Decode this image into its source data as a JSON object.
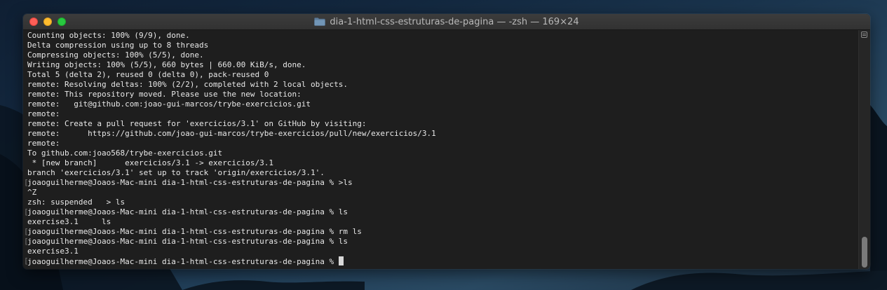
{
  "window": {
    "title": "dia-1-html-css-estruturas-de-pagina — -zsh — 169×24",
    "folder_icon": "folder-icon"
  },
  "terminal": {
    "lines": [
      {
        "text": "Counting objects: 100% (9/9), done."
      },
      {
        "text": "Delta compression using up to 8 threads"
      },
      {
        "text": "Compressing objects: 100% (5/5), done."
      },
      {
        "text": "Writing objects: 100% (5/5), 660 bytes | 660.00 KiB/s, done."
      },
      {
        "text": "Total 5 (delta 2), reused 0 (delta 0), pack-reused 0"
      },
      {
        "text": "remote: Resolving deltas: 100% (2/2), completed with 2 local objects."
      },
      {
        "text": "remote: This repository moved. Please use the new location:"
      },
      {
        "text": "remote:   git@github.com:joao-gui-marcos/trybe-exercicios.git"
      },
      {
        "text": "remote:"
      },
      {
        "text": "remote: Create a pull request for 'exercicios/3.1' on GitHub by visiting:"
      },
      {
        "text": "remote:      https://github.com/joao-gui-marcos/trybe-exercicios/pull/new/exercicios/3.1"
      },
      {
        "text": "remote:"
      },
      {
        "text": "To github.com:joao568/trybe-exercicios.git"
      },
      {
        "text": " * [new branch]      exercicios/3.1 -> exercicios/3.1"
      },
      {
        "text": "branch 'exercicios/3.1' set up to track 'origin/exercicios/3.1'."
      },
      {
        "text": "joaoguilherme@Joaos-Mac-mini dia-1-html-css-estruturas-de-pagina % >ls",
        "marked": true
      },
      {
        "text": "^Z"
      },
      {
        "text": "zsh: suspended   > ls"
      },
      {
        "text": "joaoguilherme@Joaos-Mac-mini dia-1-html-css-estruturas-de-pagina % ls",
        "marked": true
      },
      {
        "text": "exercise3.1     ls"
      },
      {
        "text": "joaoguilherme@Joaos-Mac-mini dia-1-html-css-estruturas-de-pagina % rm ls",
        "marked": true
      },
      {
        "text": "joaoguilherme@Joaos-Mac-mini dia-1-html-css-estruturas-de-pagina % ls",
        "marked": true
      },
      {
        "text": "exercise3.1"
      },
      {
        "text": "joaoguilherme@Joaos-Mac-mini dia-1-html-css-estruturas-de-pagina % ",
        "prompt": true,
        "marked": true
      }
    ],
    "mark_left": "[",
    "mark_right": "]"
  },
  "colors": {
    "close": "#fe5f57",
    "minimize": "#febc2e",
    "maximize": "#28c840",
    "terminal_bg": "#1e1e1e",
    "text": "#e8e8e8"
  }
}
